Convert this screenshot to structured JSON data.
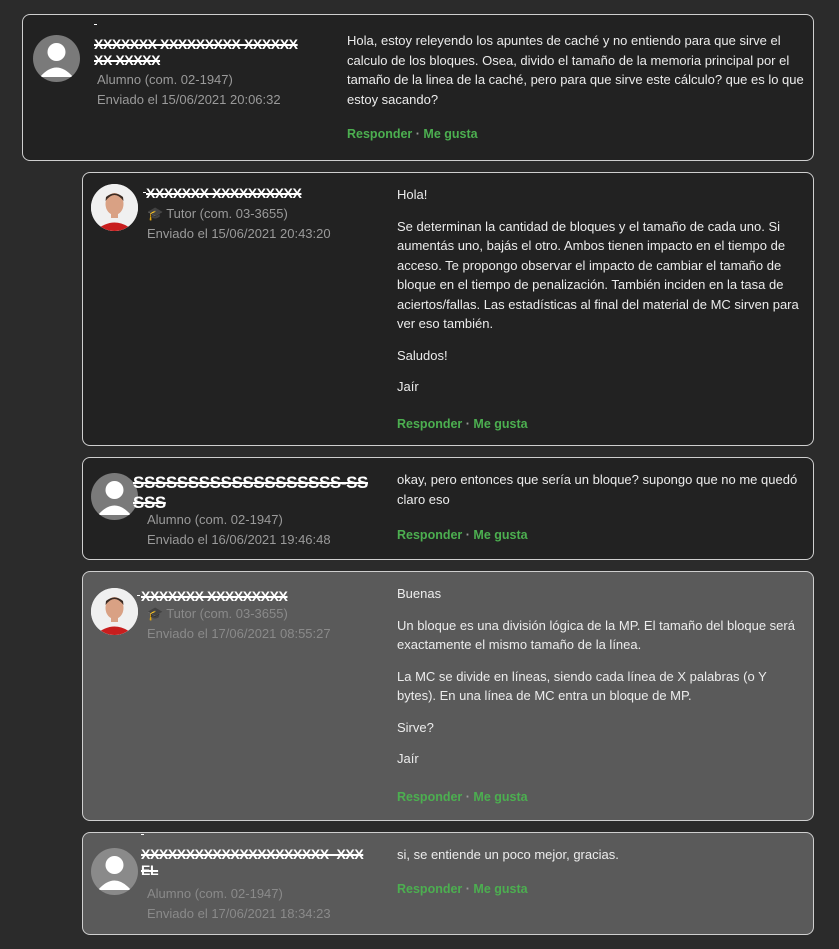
{
  "posts": [
    {
      "author": "XXXXXXX XXXXXXXXX XXXXXXXX XXXXX",
      "role": "Alumno (com. 02-1947)",
      "date": "Enviado el 15/06/2021 20:06:32",
      "paragraphs": [
        "Hola, estoy releyendo los apuntes de caché y no entiendo para que sirve el calculo de los bloques. Osea, divido el tamaño de la memoria principal por el tamaño de la linea de la caché, pero para que sirve este cálculo? que es lo que estoy sacando?"
      ],
      "reply_label": "Responder",
      "like_label": "Me gusta"
    },
    {
      "author": "XXXXXXX XXXXXXXXXX",
      "role": "Tutor (com. 03-3655)",
      "date": "Enviado el 15/06/2021 20:43:20",
      "paragraphs": [
        "Hola!",
        "Se determinan la cantidad de bloques y el tamaño de cada uno. Si aumentás uno, bajás el otro. Ambos tienen impacto en el tiempo de acceso. Te propongo observar el impacto de cambiar el tamaño de bloque en el tiempo de penalización. También inciden en la tasa de aciertos/fallas. Las estadísticas al final del material de MC sirven para ver eso también.",
        "Saludos!",
        "Jaír"
      ],
      "reply_label": "Responder",
      "like_label": "Me gusta"
    },
    {
      "author": "SSSSSSSSSSSSSSSSSSS-SSSSS",
      "role": "Alumno (com. 02-1947)",
      "date": "Enviado el 16/06/2021 19:46:48",
      "paragraphs": [
        "okay, pero entonces que sería un bloque? supongo que no me quedó claro eso"
      ],
      "reply_label": "Responder",
      "like_label": "Me gusta"
    },
    {
      "author": "XXXXXXX XXXXXXXXX",
      "role": "Tutor (com. 03-3655)",
      "date": "Enviado el 17/06/2021 08:55:27",
      "paragraphs": [
        "Buenas",
        "Un bloque es una división lógica de la MP. El tamaño del bloque será exactamente el mismo tamaño de la línea.",
        "La MC se divide en líneas, siendo cada línea de X palabras (o Y bytes). En una línea de MC entra un bloque de MP.",
        "Sirve?",
        "Jaír"
      ],
      "reply_label": "Responder",
      "like_label": "Me gusta"
    },
    {
      "author": "XXXXXXXXXXXXXXXXXXXXX- XXXEL",
      "role": "Alumno (com. 02-1947)",
      "date": "Enviado el 17/06/2021 18:34:23",
      "paragraphs": [
        "si, se entiende un poco mejor, gracias."
      ],
      "reply_label": "Responder",
      "like_label": "Me gusta"
    }
  ],
  "icons": {
    "default_avatar": "user-silhouette-icon",
    "tutor_avatar": "tutor-photo-avatar",
    "tutor_badge": "graduation-cap-icon"
  },
  "colors": {
    "link_green": "#4caf50",
    "cap_gold": "#e0a020",
    "highlight_bg": "#5a5a5a"
  }
}
